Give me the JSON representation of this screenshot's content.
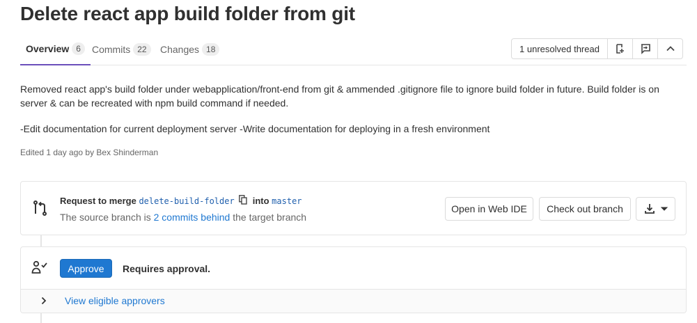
{
  "title": "Delete react app build folder from git",
  "tabs": [
    {
      "label": "Overview",
      "count": "6"
    },
    {
      "label": "Commits",
      "count": "22"
    },
    {
      "label": "Changes",
      "count": "18"
    }
  ],
  "threads": {
    "label": "1 unresolved thread"
  },
  "description": {
    "paragraph1": "Removed react app's build folder under webapplication/front-end from git & ammended .gitignore file to ignore build folder in future. Build folder is on server & can be recreated with npm build command if needed.",
    "paragraph2": "-Edit documentation for current deployment server -Write documentation for deploying in a fresh environment",
    "edited": "Edited 1 day ago by Bex Shinderman"
  },
  "merge": {
    "request_text": "Request to merge",
    "source_branch": "delete-build-folder",
    "into_text": "into",
    "target_branch": "master",
    "status_prefix": "The source branch is",
    "behind_link": "2 commits behind",
    "status_suffix": "the target branch",
    "open_ide_label": "Open in Web IDE",
    "checkout_label": "Check out branch"
  },
  "approval": {
    "approve_label": "Approve",
    "requires_text": "Requires approval.",
    "eligible_link": "View eligible approvers"
  },
  "icons": {
    "merge": "merge-request-icon",
    "copy": "copy-icon",
    "download": "download-icon",
    "approval": "approval-user-icon"
  },
  "colors": {
    "accent": "#6b4fbb",
    "link": "#1f78d1",
    "approve": "#1f78d1"
  }
}
